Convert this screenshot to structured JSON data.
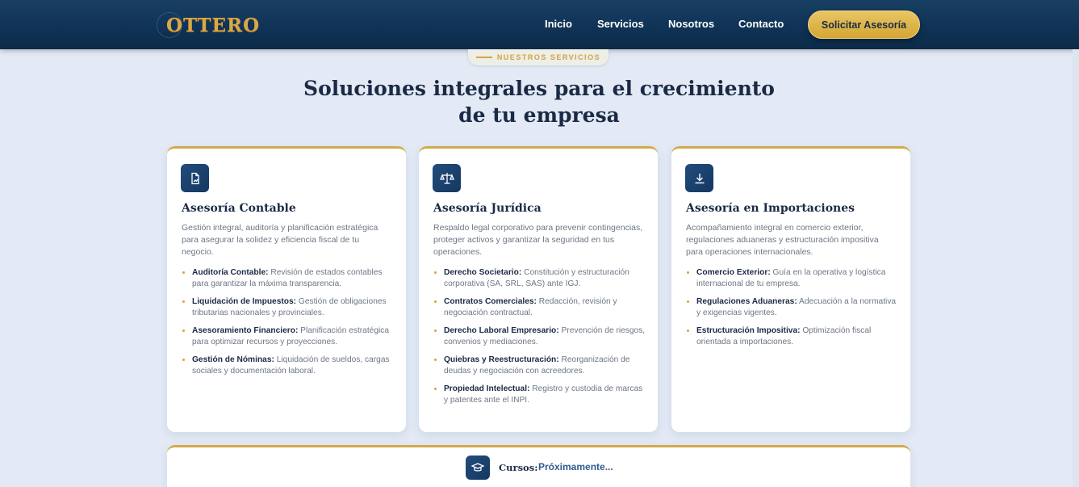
{
  "header": {
    "logo_text": "OTTERO",
    "nav": [
      "Inicio",
      "Servicios",
      "Nosotros",
      "Contacto"
    ],
    "cta_label": "Solicitar Asesoría"
  },
  "section": {
    "badge": "NUESTROS SERVICIOS",
    "title_line1": "Soluciones integrales para el crecimiento",
    "title_line2": "de tu empresa"
  },
  "cards": [
    {
      "icon": "document-chart-icon",
      "title": "Asesoría Contable",
      "description": "Gestión integral, auditoría y planificación estratégica para asegurar la solidez y eficiencia fiscal de tu negocio.",
      "items": [
        {
          "label": "Auditoría Contable:",
          "text": " Revisión de estados contables para garantizar la máxima transparencia."
        },
        {
          "label": "Liquidación de Impuestos:",
          "text": " Gestión de obligaciones tributarias nacionales y provinciales."
        },
        {
          "label": "Asesoramiento Financiero:",
          "text": " Planificación estratégica para optimizar recursos y proyecciones."
        },
        {
          "label": "Gestión de Nóminas:",
          "text": " Liquidación de sueldos, cargas sociales y documentación laboral."
        }
      ]
    },
    {
      "icon": "scale-icon",
      "title": "Asesoría Jurídica",
      "description": "Respaldo legal corporativo para prevenir contingencias, proteger activos y garantizar la seguridad en tus operaciones.",
      "items": [
        {
          "label": "Derecho Societario:",
          "text": " Constitución y estructuración corporativa (SA, SRL, SAS) ante IGJ."
        },
        {
          "label": "Contratos Comerciales:",
          "text": " Redacción, revisión y negociación contractual."
        },
        {
          "label": "Derecho Laboral Empresario:",
          "text": " Prevención de riesgos, convenios y mediaciones."
        },
        {
          "label": "Quiebras y Reestructuración:",
          "text": " Reorganización de deudas y negociación con acreedores."
        },
        {
          "label": "Propiedad Intelectual:",
          "text": " Registro y custodia de marcas y patentes ante el INPI."
        }
      ]
    },
    {
      "icon": "download-icon",
      "title": "Asesoría en Importaciones",
      "description": "Acompañamiento integral en comercio exterior, regulaciones aduaneras y estructuración impositiva para operaciones internacionales.",
      "items": [
        {
          "label": "Comercio Exterior:",
          "text": " Guía en la operativa y logística internacional de tu empresa."
        },
        {
          "label": "Regulaciones Aduaneras:",
          "text": " Adecuación a la normativa y exigencias vigentes."
        },
        {
          "label": "Estructuración Impositiva:",
          "text": " Optimización fiscal orientada a importaciones."
        }
      ]
    }
  ],
  "courses": {
    "icon": "graduation-cap-icon",
    "label": "Cursos:",
    "value": "Próximamente..."
  },
  "colors": {
    "navy": "#0f3255",
    "gold": "#d4a63a",
    "background": "#e3eaf6"
  }
}
